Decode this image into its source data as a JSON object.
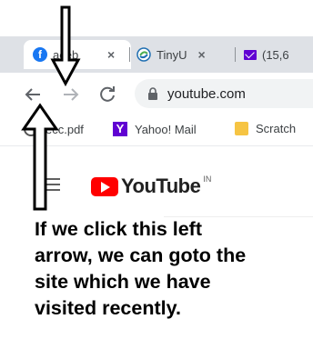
{
  "tabs": [
    {
      "label": "aceb",
      "icon": "facebook-icon",
      "close": "×"
    },
    {
      "label": "TinyU",
      "icon": "tinyurl-icon",
      "close": "×"
    },
    {
      "label": "(15,6",
      "icon": "yahoo-mail-icon"
    }
  ],
  "toolbar": {
    "back_icon": "back-arrow-icon",
    "forward_icon": "forward-arrow-icon",
    "reload_icon": "reload-icon",
    "url": "youtube.com"
  },
  "bookmarks": [
    {
      "label": "ecc.pdf",
      "icon": "pdf-icon"
    },
    {
      "label": "Yahoo! Mail",
      "icon": "yahoo-icon",
      "icon_text": "Y"
    },
    {
      "label": "Scratch",
      "icon": "folder-icon"
    }
  ],
  "youtube": {
    "logo_text": "YouTube",
    "country_code": "IN"
  },
  "annotation": {
    "lines": [
      "If we click this left",
      "arrow, we can goto the",
      "site which we have",
      "visited recently."
    ]
  },
  "colors": {
    "tabstrip": "#dee1e6",
    "youtube_red": "#ff0000",
    "yahoo_purple": "#6001d2",
    "facebook_blue": "#1877f2"
  }
}
